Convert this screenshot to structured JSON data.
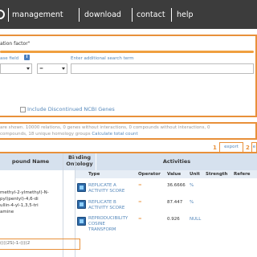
{
  "nav": {
    "items": [
      {
        "label": "management"
      },
      {
        "label": "download"
      },
      {
        "label": "contact"
      },
      {
        "label": "help"
      }
    ]
  },
  "search": {
    "title_fragment": "ation factor\"",
    "field_label": "ase field",
    "additional_label": "Enter additional search term",
    "operator_value": "=",
    "include_label": "Include Discontinued NCBI Genes"
  },
  "info": {
    "line1": "are shown. 10000 relations, 0 genes without interactions, 0 compounds without interactions, 0",
    "line2": "compounds, 18 unique homology groups",
    "calc_link": "Calculate total count"
  },
  "export": {
    "btn1_num": "1",
    "btn1_label": "export",
    "btn2_num": "2",
    "btn2_label": "e"
  },
  "table": {
    "headers": {
      "compound": "pound Name",
      "binding1": "Binding",
      "binding2": "Ontology",
      "activities": "Activities"
    },
    "subheaders": {
      "type": "Type",
      "operator": "Operator",
      "value": "Value",
      "unit": "Unit",
      "strength": "Strength",
      "reference": "Refere"
    },
    "compound_lines": [
      "methyl-2-ylmethyl)-N-",
      "pyl)pentyl)-4,6-di",
      "ullin-4-yl-1,3,5-tri",
      "amine"
    ],
    "rows": [
      {
        "type1": "REPLICATE A",
        "type2": "ACTIVITY SCORE",
        "operator": "=",
        "value": "36.6666",
        "unit": "%"
      },
      {
        "type1": "REPLICATE B",
        "type2": "ACTIVITY SCORE",
        "operator": "=",
        "value": "87.447",
        "unit": "%"
      },
      {
        "type1": "REPRODUCIBILITY",
        "type2": "COSINE",
        "type3": "TRANSFORM",
        "operator": "=",
        "value": "0.926",
        "unit": "NULL"
      }
    ],
    "bottom_fragment": "((((2S)-1-((((2"
  },
  "colors": {
    "nav_bg": "#3c3c3c",
    "highlight": "#e8903a",
    "link": "#5588bb",
    "table_header": "#d6e1ee"
  }
}
